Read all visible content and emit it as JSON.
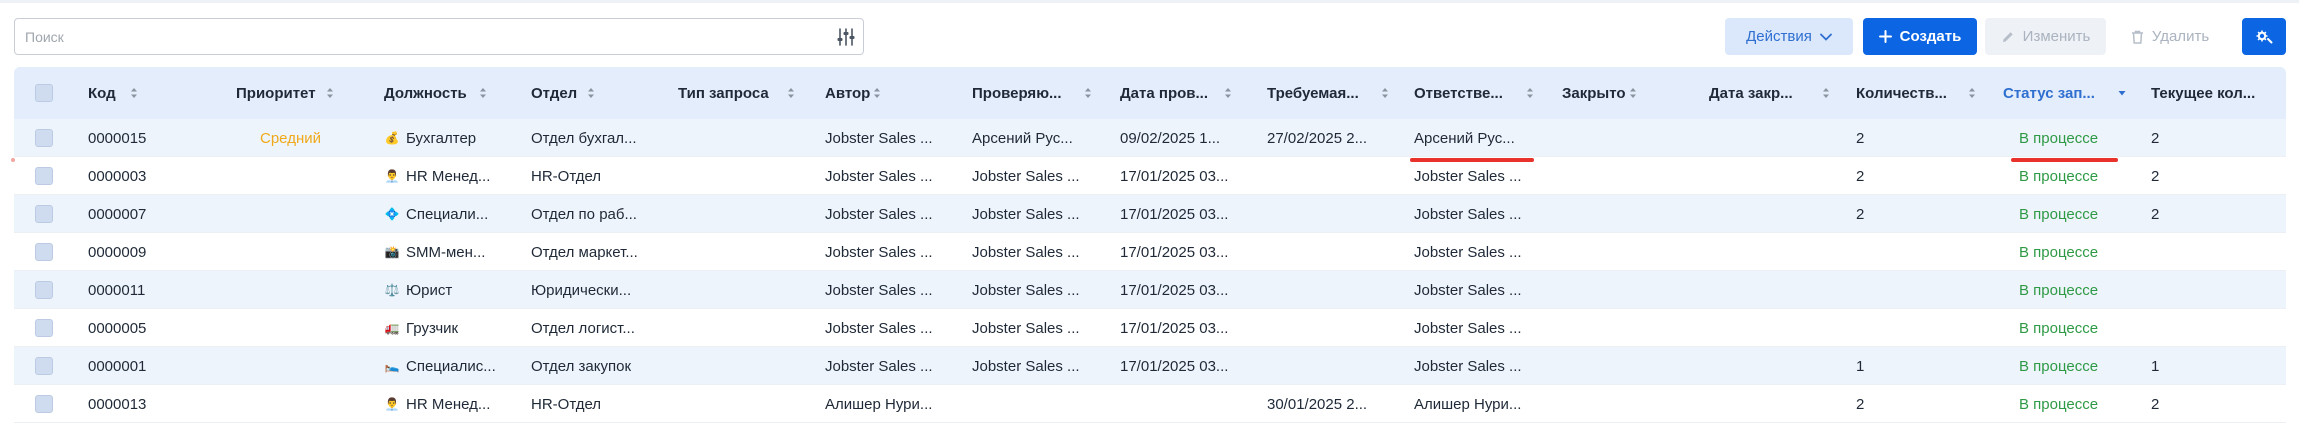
{
  "search": {
    "placeholder": "Поиск"
  },
  "toolbar": {
    "actions_label": "Действия",
    "create_label": "Создать",
    "edit_label": "Изменить",
    "delete_label": "Удалить"
  },
  "columns": [
    {
      "label": "Код"
    },
    {
      "label": "Приоритет"
    },
    {
      "label": "Должность"
    },
    {
      "label": "Отдел"
    },
    {
      "label": "Тип запроса"
    },
    {
      "label": "Автор"
    },
    {
      "label": "Проверяю..."
    },
    {
      "label": "Дата пров..."
    },
    {
      "label": "Требуемая..."
    },
    {
      "label": "Ответстве..."
    },
    {
      "label": "Закрыто"
    },
    {
      "label": "Дата закр..."
    },
    {
      "label": "Количеств..."
    },
    {
      "label": "Статус зап..."
    },
    {
      "label": "Текущее кол..."
    }
  ],
  "rows": [
    {
      "code": "0000015",
      "priority": "Средний",
      "position_icon": "💰",
      "position": "Бухгалтер",
      "department": "Отдел бухгал...",
      "request_type": "",
      "author": "Jobster Sales ...",
      "reviewer": "Арсений Рус...",
      "review_date": "09/02/2025 1...",
      "required": "27/02/2025 2...",
      "responsible": "Арсений Рус...",
      "closed": "",
      "close_date": "",
      "quantity": "2",
      "status": "В процессе",
      "current": "2"
    },
    {
      "code": "0000003",
      "priority": "",
      "position_icon": "👨‍💼",
      "position": "HR Менед...",
      "department": "HR-Отдел",
      "request_type": "",
      "author": "Jobster Sales ...",
      "reviewer": "Jobster Sales ...",
      "review_date": "17/01/2025 03...",
      "required": "",
      "responsible": "Jobster Sales ...",
      "closed": "",
      "close_date": "",
      "quantity": "2",
      "status": "В процессе",
      "current": "2"
    },
    {
      "code": "0000007",
      "priority": "",
      "position_icon": "💠",
      "position": "Специали...",
      "department": "Отдел по раб...",
      "request_type": "",
      "author": "Jobster Sales ...",
      "reviewer": "Jobster Sales ...",
      "review_date": "17/01/2025 03...",
      "required": "",
      "responsible": "Jobster Sales ...",
      "closed": "",
      "close_date": "",
      "quantity": "2",
      "status": "В процессе",
      "current": "2"
    },
    {
      "code": "0000009",
      "priority": "",
      "position_icon": "📸",
      "position": "SMM-мен...",
      "department": "Отдел маркет...",
      "request_type": "",
      "author": "Jobster Sales ...",
      "reviewer": "Jobster Sales ...",
      "review_date": "17/01/2025 03...",
      "required": "",
      "responsible": "Jobster Sales ...",
      "closed": "",
      "close_date": "",
      "quantity": "",
      "status": "В процессе",
      "current": ""
    },
    {
      "code": "0000011",
      "priority": "",
      "position_icon": "⚖️",
      "position": "Юрист",
      "department": "Юридически...",
      "request_type": "",
      "author": "Jobster Sales ...",
      "reviewer": "Jobster Sales ...",
      "review_date": "17/01/2025 03...",
      "required": "",
      "responsible": "Jobster Sales ...",
      "closed": "",
      "close_date": "",
      "quantity": "",
      "status": "В процессе",
      "current": ""
    },
    {
      "code": "0000005",
      "priority": "",
      "position_icon": "🚛",
      "position": "Грузчик",
      "department": "Отдел логист...",
      "request_type": "",
      "author": "Jobster Sales ...",
      "reviewer": "Jobster Sales ...",
      "review_date": "17/01/2025 03...",
      "required": "",
      "responsible": "Jobster Sales ...",
      "closed": "",
      "close_date": "",
      "quantity": "",
      "status": "В процессе",
      "current": ""
    },
    {
      "code": "0000001",
      "priority": "",
      "position_icon": "🛌",
      "position": "Специалис...",
      "department": "Отдел закупок",
      "request_type": "",
      "author": "Jobster Sales ...",
      "reviewer": "Jobster Sales ...",
      "review_date": "17/01/2025 03...",
      "required": "",
      "responsible": "Jobster Sales ...",
      "closed": "",
      "close_date": "",
      "quantity": "1",
      "status": "В процессе",
      "current": "1"
    },
    {
      "code": "0000013",
      "priority": "",
      "position_icon": "👨‍💼",
      "position": "HR Менед...",
      "department": "HR-Отдел",
      "request_type": "",
      "author": "Алишер Нури...",
      "reviewer": "",
      "review_date": "",
      "required": "30/01/2025 2...",
      "responsible": "Алишер Нури...",
      "closed": "",
      "close_date": "",
      "quantity": "2",
      "status": "В процессе",
      "current": "2"
    }
  ],
  "colors": {
    "accent": "#0c66e4",
    "header_bg": "#e3edfb",
    "row_alt": "#eef4fc",
    "priority_medium": "#f0a91a",
    "status_in_progress": "#2e9a45",
    "annotation": "#e8322b"
  },
  "icons": {
    "filter": "sliders-icon",
    "actions_chevron": "chevron-down-icon",
    "create": "plus-icon",
    "edit": "pencil-icon",
    "delete": "trash-icon",
    "settings": "gear-settings-icon",
    "sort": "sort-arrows-icon"
  }
}
